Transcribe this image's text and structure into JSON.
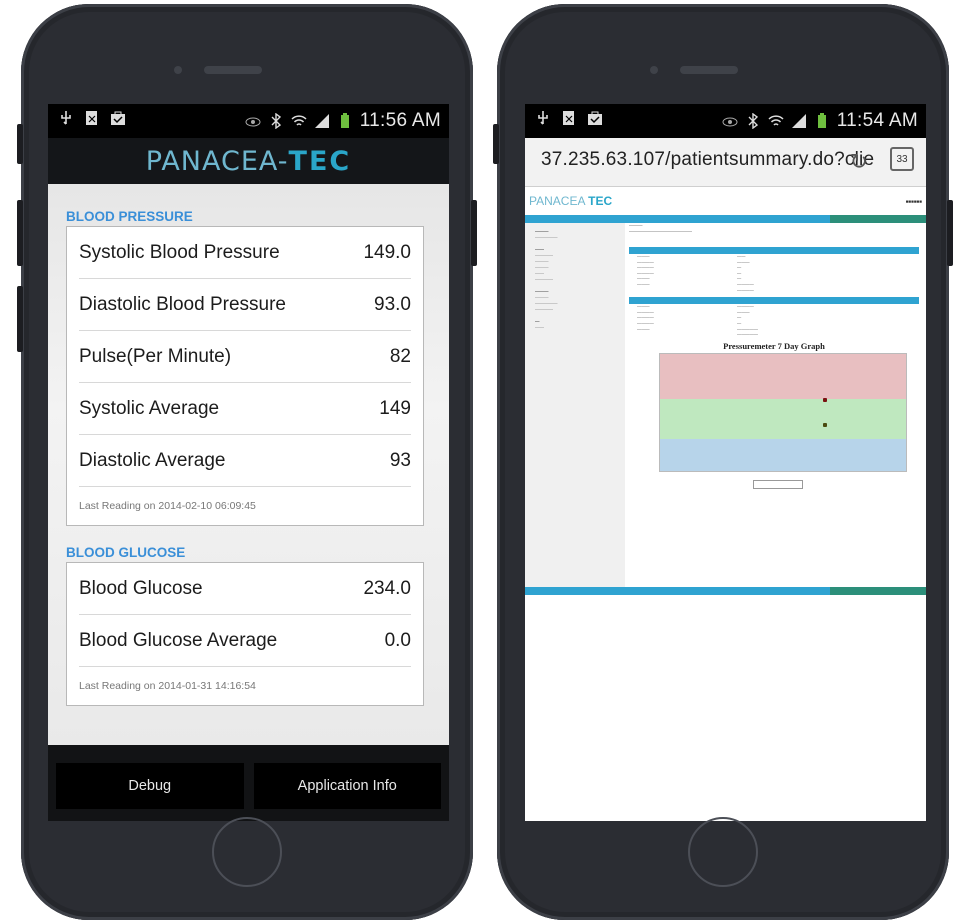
{
  "left_phone": {
    "status": {
      "time": "11:56 AM"
    },
    "app_logo": {
      "part1": "PANACEA-",
      "part2": "TEC"
    },
    "blood_pressure": {
      "title": "BLOOD PRESSURE",
      "rows": [
        {
          "label": "Systolic Blood Pressure",
          "value": "149.0"
        },
        {
          "label": "Diastolic Blood Pressure",
          "value": "93.0"
        },
        {
          "label": "Pulse(Per Minute)",
          "value": "82"
        },
        {
          "label": "Systolic Average",
          "value": "149"
        },
        {
          "label": "Diastolic Average",
          "value": "93"
        }
      ],
      "last_reading": "Last Reading on 2014-02-10 06:09:45"
    },
    "blood_glucose": {
      "title": "BLOOD GLUCOSE",
      "rows": [
        {
          "label": "Blood Glucose",
          "value": "234.0"
        },
        {
          "label": "Blood Glucose Average",
          "value": "0.0"
        }
      ],
      "last_reading": "Last Reading on 2014-01-31 14:16:54"
    },
    "footer": {
      "debug_label": "Debug",
      "app_info_label": "Application Info"
    }
  },
  "right_phone": {
    "status": {
      "time": "11:54 AM"
    },
    "browser": {
      "url": "37.235.63.107/patientsummary.do?clie",
      "tab_count": "33"
    },
    "web_logo": {
      "part1": "PANACEA ",
      "part2": "TEC"
    },
    "graph": {
      "title": "Pressuremeter 7 Day Graph"
    }
  },
  "colors": {
    "accent_blue": "#3a8fd8",
    "header_teal": "#2aa6c9",
    "web_bar": "#2fa3d1",
    "band_red": "#e8bfc1",
    "band_green": "#bfe8bf",
    "band_blue": "#b7d4ea"
  }
}
